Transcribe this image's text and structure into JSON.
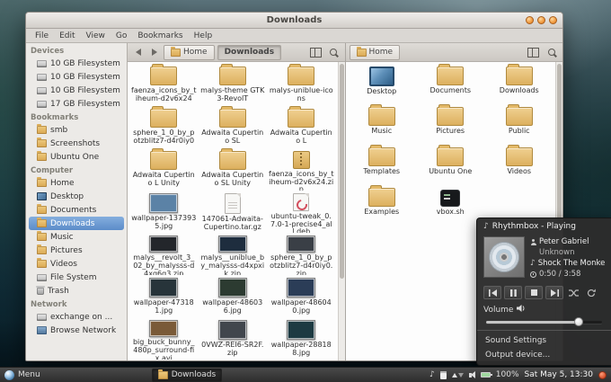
{
  "colors": {
    "selection": "#5c8cc9",
    "folder": "#ddb05e",
    "panel_bg": "#2d2d2d",
    "window_button": "#f09a3e"
  },
  "window": {
    "title": "Downloads",
    "menu": [
      "File",
      "Edit",
      "View",
      "Go",
      "Bookmarks",
      "Help"
    ],
    "sidebar": {
      "sections": [
        {
          "label": "Devices",
          "items": [
            {
              "label": "10 GB Filesystem",
              "icon": "drive"
            },
            {
              "label": "10 GB Filesystem",
              "icon": "drive"
            },
            {
              "label": "10 GB Filesystem",
              "icon": "drive"
            },
            {
              "label": "17 GB Filesystem",
              "icon": "drive"
            }
          ]
        },
        {
          "label": "Bookmarks",
          "items": [
            {
              "label": "smb",
              "icon": "folder"
            },
            {
              "label": "Screenshots",
              "icon": "folder"
            },
            {
              "label": "Ubuntu One",
              "icon": "folder"
            }
          ]
        },
        {
          "label": "Computer",
          "items": [
            {
              "label": "Home",
              "icon": "home"
            },
            {
              "label": "Desktop",
              "icon": "desktop"
            },
            {
              "label": "Documents",
              "icon": "folder"
            },
            {
              "label": "Downloads",
              "icon": "folder",
              "selected": true
            },
            {
              "label": "Music",
              "icon": "folder"
            },
            {
              "label": "Pictures",
              "icon": "folder"
            },
            {
              "label": "Videos",
              "icon": "folder"
            },
            {
              "label": "File System",
              "icon": "drive"
            },
            {
              "label": "Trash",
              "icon": "trash"
            }
          ]
        },
        {
          "label": "Network",
          "items": [
            {
              "label": "exchange on ...",
              "icon": "drive"
            },
            {
              "label": "Browse Network",
              "icon": "network"
            }
          ]
        }
      ]
    },
    "left_pane": {
      "crumbs": {
        "root": "Home",
        "current": "Downloads"
      },
      "items": [
        {
          "label": "faenza_icons_by_tiheum-d2v6x24",
          "type": "folder"
        },
        {
          "label": "malys-theme GTK3-RevolT",
          "type": "folder"
        },
        {
          "label": "malys-uniblue-icons",
          "type": "folder"
        },
        {
          "label": "sphere_1_0_by_potzblitz7-d4r0iy0",
          "type": "folder"
        },
        {
          "label": "Adwaita Cupertino SL",
          "type": "folder"
        },
        {
          "label": "Adwaita Cupertino L",
          "type": "folder"
        },
        {
          "label": "Adwaita Cupertino L Unity",
          "type": "folder"
        },
        {
          "label": "Adwaita Cupertino SL Unity",
          "type": "folder"
        },
        {
          "label": "faenza_icons_by_tiheum-d2v6x24.zip",
          "type": "archive"
        },
        {
          "label": "wallpaper-1373935.jpg",
          "type": "image",
          "thumb": "#5b82a6"
        },
        {
          "label": "147061-Adwaita-Cupertino.tar.gz",
          "type": "tarball"
        },
        {
          "label": "ubuntu-tweak_0.7.0-1-precise4_all.deb",
          "type": "deb"
        },
        {
          "label": "malys__revolt_3_02_by_malysss-d4xq6q3.zip",
          "type": "image",
          "thumb": "#23262b"
        },
        {
          "label": "malys__uniblue_by_malysss-d4xpxik.zip",
          "type": "image",
          "thumb": "#1e2d3e"
        },
        {
          "label": "sphere_1_0_by_potzblitz7-d4r0iy0.zip",
          "type": "image",
          "thumb": "#3a3f46"
        },
        {
          "label": "wallpaper-473181.jpg",
          "type": "image",
          "thumb": "#27343a"
        },
        {
          "label": "wallpaper-486036.jpg",
          "type": "image",
          "thumb": "#2c3b31"
        },
        {
          "label": "wallpaper-486040.jpg",
          "type": "image",
          "thumb": "#2b3d57"
        },
        {
          "label": "big_buck_bunny_480p_surround-fix.avi",
          "type": "video",
          "thumb": "#7a5a38"
        },
        {
          "label": "0VWZ-REI6-SR2F.zip",
          "type": "image",
          "thumb": "#41464d"
        },
        {
          "label": "wallpaper-288188.jpg",
          "type": "image",
          "thumb": "#1d3a42"
        }
      ]
    },
    "right_pane": {
      "crumbs": {
        "root": "Home"
      },
      "items": [
        {
          "label": "Desktop",
          "type": "desktop"
        },
        {
          "label": "Documents",
          "type": "folder"
        },
        {
          "label": "Downloads",
          "type": "folder"
        },
        {
          "label": "Music",
          "type": "folder"
        },
        {
          "label": "Pictures",
          "type": "folder"
        },
        {
          "label": "Public",
          "type": "folder"
        },
        {
          "label": "Templates",
          "type": "folder"
        },
        {
          "label": "Ubuntu One",
          "type": "folder"
        },
        {
          "label": "Videos",
          "type": "folder"
        },
        {
          "label": "Examples",
          "type": "folder"
        },
        {
          "label": "vbox.sh",
          "type": "script"
        }
      ]
    }
  },
  "rhythmbox": {
    "title": "Rhythmbox - Playing",
    "artist": "Peter Gabriel",
    "album": "Unknown",
    "track": "Shock The Monkey",
    "time": "0:50 / 3:58",
    "volume_label": "Volume",
    "volume_percent": 80,
    "menu": [
      "Sound Settings",
      "Output device..."
    ]
  },
  "panel": {
    "menu_label": "Menu",
    "task_label": "Downloads",
    "battery": "100%",
    "clock": "Sat May 5, 13:30"
  }
}
